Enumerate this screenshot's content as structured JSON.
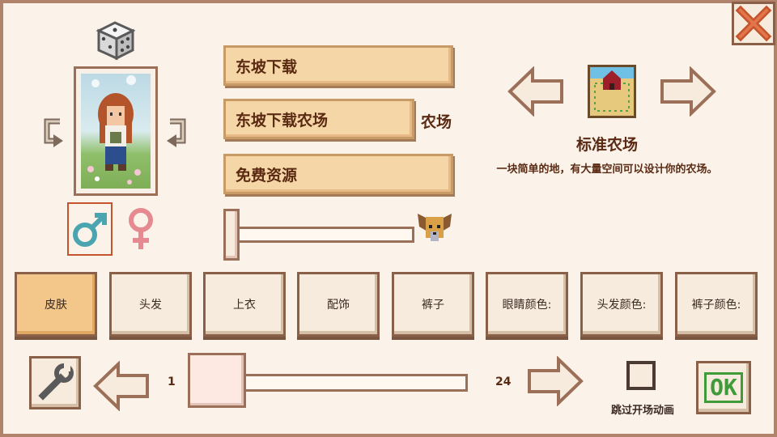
{
  "fields": {
    "name_value": "东坡下载",
    "farm_name_value": "东坡下载农场",
    "farm_suffix": "农场",
    "favorite_thing_value": "免费资源"
  },
  "pet_slider": {
    "level": 0.0
  },
  "farm_type": {
    "title": "标准农场",
    "description": "一块简单的地，有大量空间可以设计你的农场。"
  },
  "tabs": [
    {
      "label": "皮肤",
      "active": true
    },
    {
      "label": "头发",
      "active": false
    },
    {
      "label": "上衣",
      "active": false
    },
    {
      "label": "配饰",
      "active": false
    },
    {
      "label": "裤子",
      "active": false
    },
    {
      "label": "眼睛颜色:",
      "active": false
    },
    {
      "label": "头发颜色:",
      "active": false
    },
    {
      "label": "裤子颜色:",
      "active": false
    }
  ],
  "bottom_slider": {
    "min_label": "1",
    "max_label": "24",
    "value": 1
  },
  "skip_intro": {
    "label": "跳过开场动画",
    "checked": false
  },
  "ok_button": {
    "label": "OK"
  },
  "gender": {
    "selected": "male"
  },
  "colors": {
    "accent_orange": "#f3c789",
    "border_brown": "#8a6048",
    "ok_green": "#3f9a3a",
    "male_blue": "#4aa5b0",
    "female_pink": "#e48a90",
    "close_red": "#c5542d"
  },
  "icons": [
    "dice-icon",
    "rotate-left-icon",
    "rotate-right-icon",
    "male-icon",
    "female-icon",
    "dog-icon",
    "farm-icon",
    "close-icon",
    "wrench-icon",
    "left-arrow-icon",
    "right-arrow-icon",
    "checkbox-icon"
  ]
}
